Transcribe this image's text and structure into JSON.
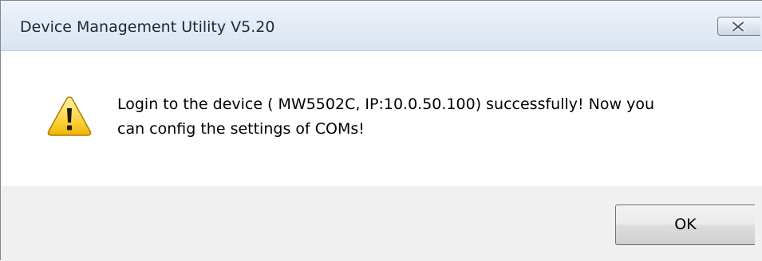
{
  "window": {
    "title": "Device Management Utility V5.20",
    "close_icon": "close-icon"
  },
  "message": {
    "icon": "warning-icon",
    "line1": "Login to the device ( MW5502C,  IP:10.0.50.100) successfully! Now you",
    "line2": "can config the settings of COMs!"
  },
  "buttons": {
    "ok_label": "OK"
  }
}
